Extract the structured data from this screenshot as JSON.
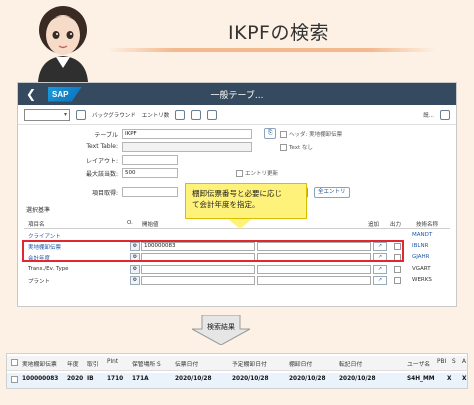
{
  "page": {
    "title": "IKPFの検索"
  },
  "sap": {
    "window_title": "一般テーブ...",
    "toolbar": {
      "btn1": "バックグラウンド",
      "btn2": "エントリ数",
      "btn3": "既...",
      "btn4": "全エントリ"
    },
    "form": {
      "table_label": "テーブル",
      "table_value": "IKPF",
      "header_checkbox": "ヘッダ: 実地棚卸伝票",
      "text_table_label": "Text Table:",
      "text_checkbox": "Text なし",
      "layout_label": "レイアウト:",
      "max_hits_label": "最大該当数:",
      "max_hits_value": "500",
      "entry_update_checkbox": "エントリ更新",
      "field_label": "項目取得:",
      "selection_heading": "選択基準"
    },
    "callout": {
      "line1": "棚卸伝票番号と必要に応じ",
      "line2": "て会計年度を指定。"
    },
    "grid": {
      "col_field": "項目名",
      "col_opt": "O.",
      "col_from": "開始値",
      "col_add": "追加",
      "col_out": "出力",
      "col_tech": "技術名称",
      "rows": [
        {
          "field": "クライアント",
          "from": "",
          "tech": "MANDT",
          "style": "blue"
        },
        {
          "field": "実地棚卸伝票",
          "from": "100000083",
          "tech": "IBLNR",
          "style": "blue"
        },
        {
          "field": "会計年度",
          "from": "",
          "tech": "GJAHR",
          "style": "blue"
        },
        {
          "field": "Trans./Ev. Type",
          "from": "",
          "tech": "VGART",
          "style": "dark"
        },
        {
          "field": "プラント",
          "from": "",
          "tech": "WERKS",
          "style": "dark"
        }
      ]
    }
  },
  "arrow_label": "検索結果",
  "result": {
    "headers": [
      "実地棚卸伝票",
      "年度",
      "取引",
      "Plnt",
      "保管場所 S",
      "伝票日付",
      "予定棚卸日付",
      "棚卸日付",
      "転記日付",
      "",
      "ユーザ名",
      "PBI",
      "S",
      "A"
    ],
    "row": [
      "100000083",
      "2020",
      "IB",
      "1710",
      "171A",
      "",
      "2020/10/28",
      "2020/10/28",
      "2020/10/28",
      "2020/10/28",
      "",
      "S4H_MM",
      "X",
      "X"
    ]
  }
}
